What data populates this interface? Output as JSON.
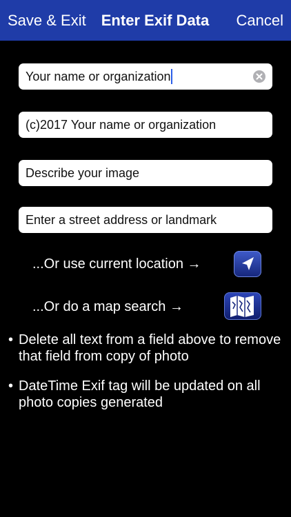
{
  "nav": {
    "left_label": "Save & Exit",
    "title": "Enter Exif Data",
    "right_label": "Cancel",
    "bar_color": "#1f3ca8"
  },
  "fields": {
    "author": {
      "value": "Your name or organization",
      "clear_icon": "clear-circle-icon"
    },
    "copyright": {
      "value": "(c)2017 Your name or organization"
    },
    "description": {
      "value": "Describe your image"
    },
    "address": {
      "value": "Enter a street address or landmark"
    }
  },
  "location": {
    "current_label": "...Or use current location →",
    "current_icon": "location-arrow-icon",
    "map_label": "...Or do a map search →",
    "map_icon": "map-icon"
  },
  "notes": {
    "bullet": "•",
    "items": [
      "Delete all text from a field above to remove that field from copy of photo",
      "DateTime Exif tag will be updated on all photo copies generated"
    ]
  }
}
